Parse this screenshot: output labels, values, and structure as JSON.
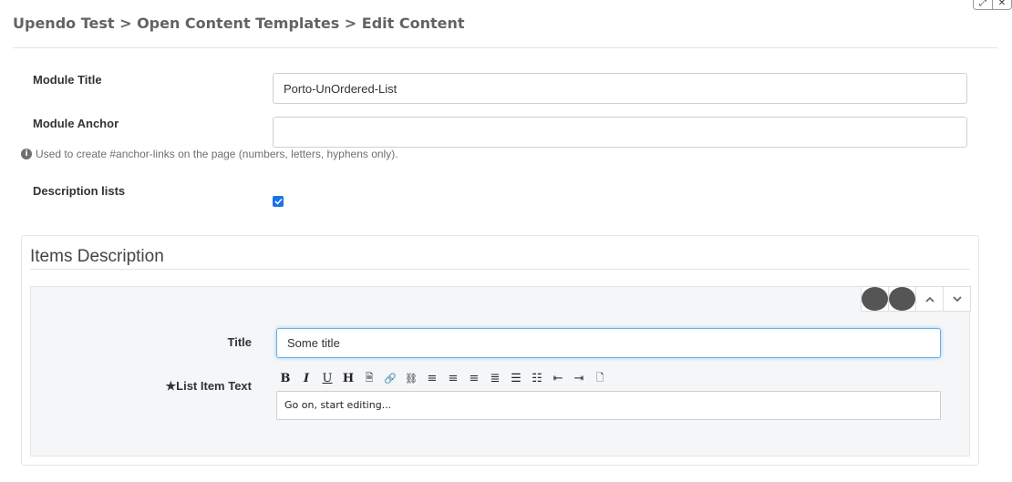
{
  "breadcrumb": "Upendo Test > Open Content Templates > Edit Content",
  "window_controls": {
    "expand": "⤢",
    "close": "✕"
  },
  "form": {
    "module_title_label": "Module Title",
    "module_title_value": "Porto-UnOrdered-List",
    "module_anchor_label": "Module Anchor",
    "module_anchor_value": "",
    "anchor_help": "Used to create #anchor-links on the page (numbers, letters, hyphens only).",
    "description_lists_label": "Description lists",
    "description_lists_checked": true
  },
  "items_panel": {
    "title": "Items Description",
    "controls": {
      "add": "+",
      "remove": "−",
      "up": "⌃",
      "down": "⌄"
    },
    "item": {
      "title_label": "Title",
      "title_value": "Some title",
      "list_item_label": "★List Item Text",
      "editor_placeholder": "Go on, start editing..."
    }
  },
  "editor_toolbar": [
    {
      "name": "bold-icon",
      "glyph": "B"
    },
    {
      "name": "italic-icon",
      "glyph": "I"
    },
    {
      "name": "underline-icon",
      "glyph": "U"
    },
    {
      "name": "heading-icon",
      "glyph": "H"
    },
    {
      "name": "paste-icon",
      "glyph": "🗎"
    },
    {
      "name": "link-icon",
      "glyph": "🔗"
    },
    {
      "name": "unlink-icon",
      "glyph": "⛓"
    },
    {
      "name": "align-left-icon",
      "glyph": "≡"
    },
    {
      "name": "align-right-icon",
      "glyph": "≡"
    },
    {
      "name": "align-center-icon",
      "glyph": "≡"
    },
    {
      "name": "align-justify-icon",
      "glyph": "≣"
    },
    {
      "name": "unordered-list-icon",
      "glyph": "☰"
    },
    {
      "name": "ordered-list-icon",
      "glyph": "☷"
    },
    {
      "name": "outdent-icon",
      "glyph": "⇤"
    },
    {
      "name": "indent-icon",
      "glyph": "⇥"
    },
    {
      "name": "source-code-icon",
      "glyph": "🗋"
    }
  ],
  "colors": {
    "accent": "#1a73e8",
    "focus_border": "#66afe9",
    "panel_bg": "#f5f6f8"
  }
}
